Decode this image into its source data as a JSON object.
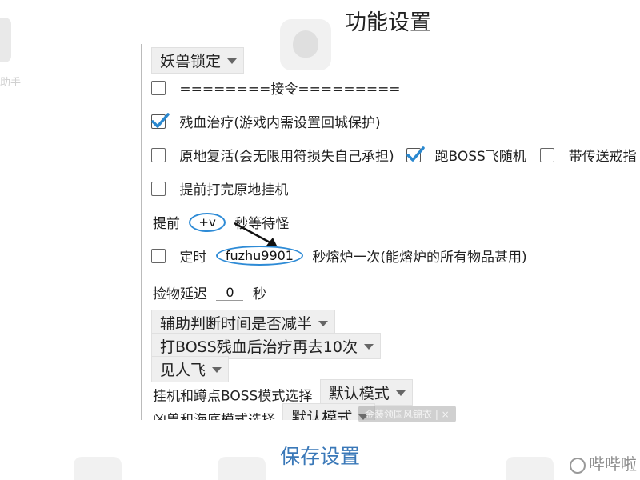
{
  "window": {
    "title": "功能设置",
    "bg_left_label": "助手"
  },
  "settings": {
    "demon_lock": {
      "selected": "妖兽锁定"
    },
    "accept_quest": {
      "checked": false,
      "label": "========接令========="
    },
    "low_hp_heal": {
      "checked": true,
      "label": "残血治疗(游戏内需设置回城保护)"
    },
    "revive_in_place": {
      "checked": false,
      "label": "原地复活(会无限用符损失自己承担)"
    },
    "run_boss_fly": {
      "checked": true,
      "label": "跑BOSS飞随机"
    },
    "with_teleport_ring": {
      "checked": false,
      "label": "带传送戒指"
    },
    "idle_after_finish": {
      "checked": false,
      "label": "提前打完原地挂机"
    },
    "wait_monster": {
      "prefix": "提前",
      "value": "+v",
      "suffix": "秒等待怪"
    },
    "timed_smelt": {
      "checked": false,
      "prefix": "定时",
      "value": "fuzhu9901",
      "suffix": "秒熔炉一次(能熔炉的所有物品甚用)"
    },
    "pickup_delay": {
      "prefix": "捡物延迟",
      "value": "0",
      "suffix": "秒"
    },
    "halve_judge_time": {
      "selected": "辅助判断时间是否减半"
    },
    "boss_low_hp_heal": {
      "selected": "打BOSS残血后治疗再去10次"
    },
    "see_player": {
      "selected": "见人飞"
    },
    "idle_boss_mode": {
      "label": "挂机和蹲点BOSS模式选择",
      "selected": "默认模式"
    },
    "fierce_sea_mode": {
      "label": "凶兽和海底模式选择",
      "selected": "默认模式"
    }
  },
  "toast": {
    "text": "金装领国风锦衣 | ×"
  },
  "footer": {
    "save_label": "保存设置",
    "watermark": "哔哔啦"
  },
  "colors": {
    "accent": "#2e8bd6",
    "save_text": "#3a78b8",
    "checkmark": "#2a88cf"
  }
}
